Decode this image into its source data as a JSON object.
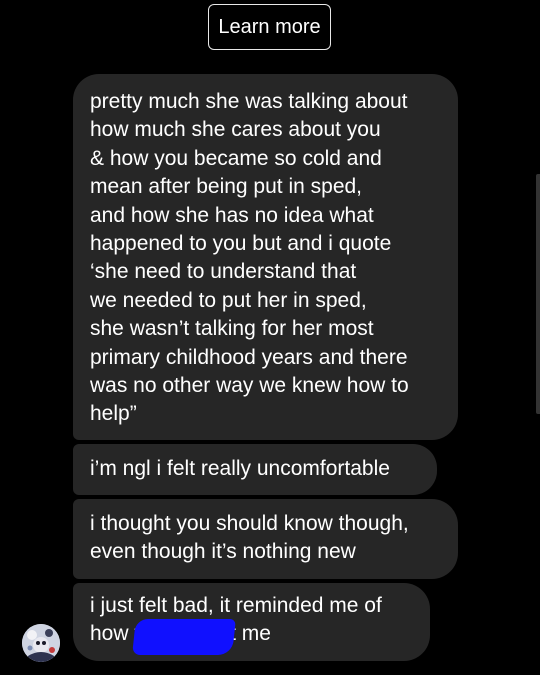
{
  "header": {
    "learn_more_label": "Learn more"
  },
  "messages": [
    {
      "text": "pretty much she was talking about\nhow much she cares about you\n& how you became so cold and\nmean after being put in sped,\nand how she has no idea what\nhappened to you but and i quote\n‘she need to understand that\nwe needed to put her in sped,\nshe wasn’t talking for her most\nprimary childhood years and there\nwas no other way we knew how to\nhelp”"
    },
    {
      "text": "i’m ngl i felt really uncomfortable"
    },
    {
      "text": "i thought you should know though,\neven though it’s nothing new"
    },
    {
      "text": "i just felt bad, it reminded me of\nhow                      talks about me"
    }
  ],
  "sender": {
    "avatar_icon": "avatar-icon"
  },
  "colors": {
    "background": "#000000",
    "bubble": "#262626",
    "text": "#ffffff",
    "redaction": "#1010ff"
  }
}
